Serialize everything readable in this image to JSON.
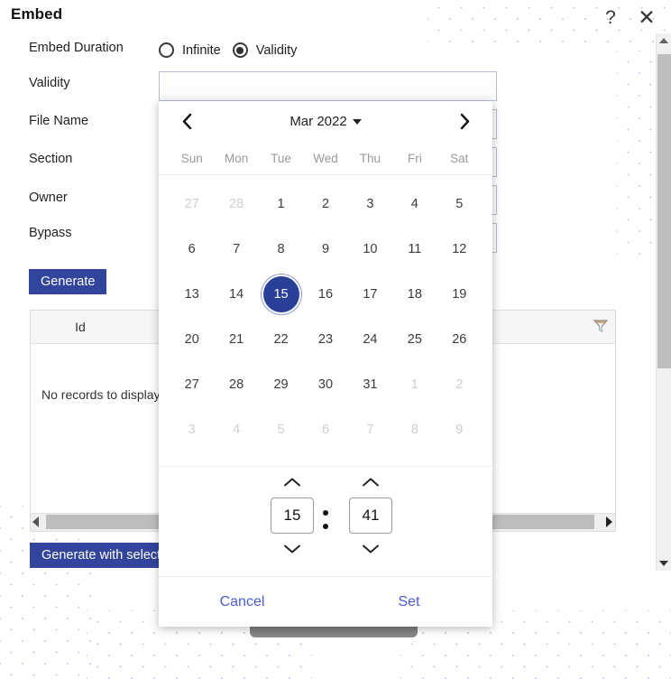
{
  "window": {
    "title": "Embed",
    "help_icon": "question-mark-icon",
    "close_icon": "close-x-icon"
  },
  "form": {
    "labels": {
      "embed_duration": "Embed Duration",
      "validity": "Validity",
      "file_name": "File Name",
      "section": "Section",
      "owner": "Owner",
      "bypass": "Bypass"
    },
    "duration_options": [
      {
        "label": "Infinite",
        "selected": false
      },
      {
        "label": "Validity",
        "selected": true
      }
    ],
    "validity_value": "",
    "validity_placeholder": ""
  },
  "buttons": {
    "generate": "Generate",
    "generate_with_selected": "Generate with selected"
  },
  "grid": {
    "columns": [
      "Id"
    ],
    "empty_message": "No records to display",
    "filter_icon": "funnel-filter-icon",
    "hscroll_left_icon": "triangle-left-icon",
    "hscroll_right_icon": "triangle-right-icon"
  },
  "scrollbar": {
    "up_icon": "triangle-up-icon",
    "down_icon": "triangle-down-icon"
  },
  "picker": {
    "prev_icon": "chevron-left-icon",
    "next_icon": "chevron-right-icon",
    "month_label": "Mar 2022",
    "dropdown_icon": "caret-down-icon",
    "weekdays": [
      "Sun",
      "Mon",
      "Tue",
      "Wed",
      "Thu",
      "Fri",
      "Sat"
    ],
    "selected_day": 15,
    "weeks": [
      [
        {
          "d": "27",
          "o": true
        },
        {
          "d": "28",
          "o": true
        },
        {
          "d": "1",
          "o": false
        },
        {
          "d": "2",
          "o": false
        },
        {
          "d": "3",
          "o": false
        },
        {
          "d": "4",
          "o": false
        },
        {
          "d": "5",
          "o": false
        }
      ],
      [
        {
          "d": "6",
          "o": false
        },
        {
          "d": "7",
          "o": false
        },
        {
          "d": "8",
          "o": false
        },
        {
          "d": "9",
          "o": false
        },
        {
          "d": "10",
          "o": false
        },
        {
          "d": "11",
          "o": false
        },
        {
          "d": "12",
          "o": false
        }
      ],
      [
        {
          "d": "13",
          "o": false
        },
        {
          "d": "14",
          "o": false
        },
        {
          "d": "15",
          "o": false,
          "sel": true
        },
        {
          "d": "16",
          "o": false
        },
        {
          "d": "17",
          "o": false
        },
        {
          "d": "18",
          "o": false
        },
        {
          "d": "19",
          "o": false
        }
      ],
      [
        {
          "d": "20",
          "o": false
        },
        {
          "d": "21",
          "o": false
        },
        {
          "d": "22",
          "o": false
        },
        {
          "d": "23",
          "o": false
        },
        {
          "d": "24",
          "o": false
        },
        {
          "d": "25",
          "o": false
        },
        {
          "d": "26",
          "o": false
        }
      ],
      [
        {
          "d": "27",
          "o": false
        },
        {
          "d": "28",
          "o": false
        },
        {
          "d": "29",
          "o": false
        },
        {
          "d": "30",
          "o": false
        },
        {
          "d": "31",
          "o": false
        },
        {
          "d": "1",
          "o": true
        },
        {
          "d": "2",
          "o": true
        }
      ],
      [
        {
          "d": "3",
          "o": true
        },
        {
          "d": "4",
          "o": true
        },
        {
          "d": "5",
          "o": true
        },
        {
          "d": "6",
          "o": true
        },
        {
          "d": "7",
          "o": true
        },
        {
          "d": "8",
          "o": true
        },
        {
          "d": "9",
          "o": true
        }
      ]
    ],
    "time": {
      "hour": "15",
      "minute": "41",
      "separator": ":",
      "hour_up_icon": "chevron-up-icon",
      "hour_down_icon": "chevron-down-icon",
      "minute_up_icon": "chevron-up-icon",
      "minute_down_icon": "chevron-down-icon"
    },
    "cancel_label": "Cancel",
    "set_label": "Set"
  },
  "colors": {
    "accent_blue": "#30459b",
    "selected_day_bg": "#2a3f98",
    "link_blue": "#4a5bd1",
    "dot_pattern": "#8c9ad6"
  }
}
